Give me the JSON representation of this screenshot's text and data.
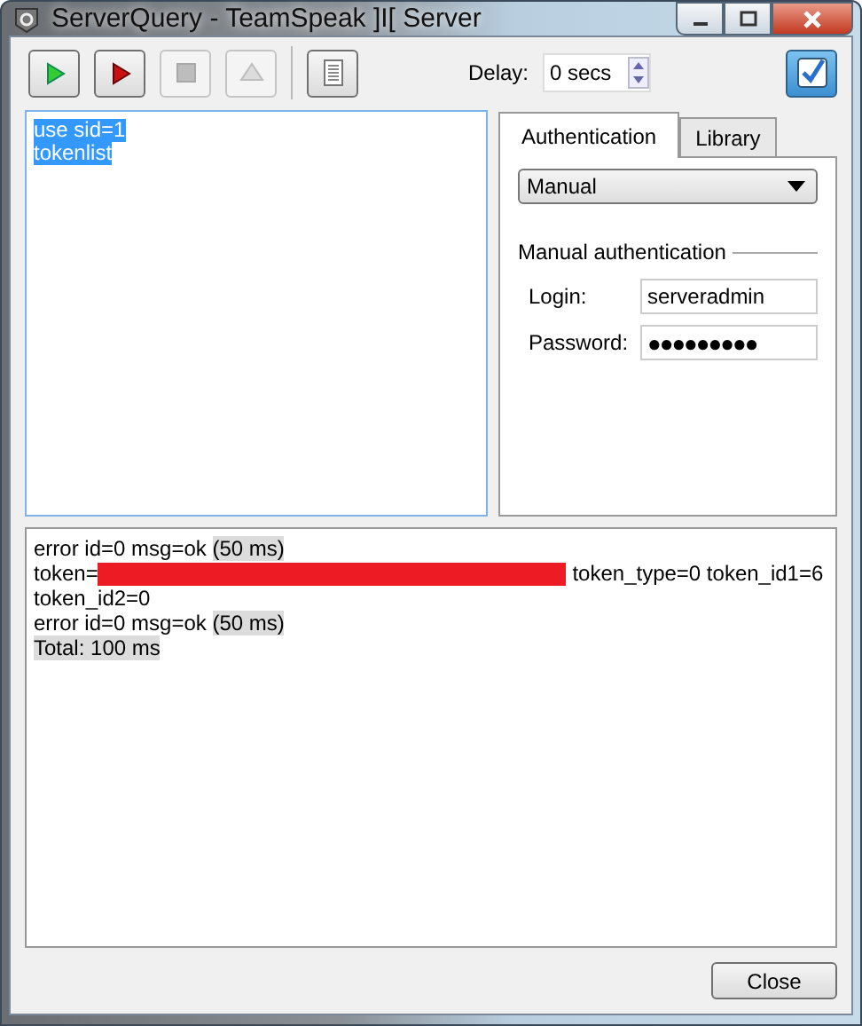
{
  "window": {
    "title": "ServerQuery - TeamSpeak ]I[ Server"
  },
  "toolbar": {
    "buttons": [
      {
        "kind": "run",
        "disabled": false
      },
      {
        "kind": "run-step",
        "disabled": false
      },
      {
        "kind": "stop",
        "disabled": true
      },
      {
        "kind": "eject",
        "disabled": true
      },
      {
        "kind": "separator"
      },
      {
        "kind": "log",
        "disabled": false
      }
    ],
    "delay": {
      "label": "Delay:",
      "value": "0 secs"
    },
    "toggle": {
      "pressed": true
    }
  },
  "editor": {
    "lines": [
      {
        "text": "use sid=1",
        "selected": true
      },
      {
        "text": "tokenlist",
        "selected": true
      }
    ]
  },
  "tabs": [
    {
      "label": "Authentication",
      "selected": true
    },
    {
      "label": "Library",
      "selected": false
    }
  ],
  "authentication": {
    "mode": "Manual",
    "group_title": "Manual authentication",
    "fields": [
      {
        "label": "Login:",
        "value": "serveradmin",
        "masked": false
      },
      {
        "label": "Password:",
        "value": "●●●●●●●●●",
        "masked": true
      }
    ]
  },
  "output": {
    "lines": [
      [
        {
          "kind": "text",
          "text": "error id=0 msg=ok ",
          "highlighted": false
        },
        {
          "kind": "text",
          "text": "(50 ms)",
          "highlighted": true
        }
      ],
      [
        {
          "kind": "text",
          "text": "token=",
          "highlighted": false
        },
        {
          "kind": "redaction"
        },
        {
          "kind": "text",
          "text": " token_type=0 token_id1=6",
          "highlighted": false
        }
      ],
      [
        {
          "kind": "text",
          "text": "token_id2=0",
          "highlighted": false
        }
      ],
      [
        {
          "kind": "text",
          "text": "error id=0 msg=ok ",
          "highlighted": false
        },
        {
          "kind": "text",
          "text": "(50 ms)",
          "highlighted": true
        }
      ],
      [
        {
          "kind": "text",
          "text": "Total: 100 ms",
          "highlighted": true
        }
      ]
    ]
  },
  "close_button": "Close"
}
